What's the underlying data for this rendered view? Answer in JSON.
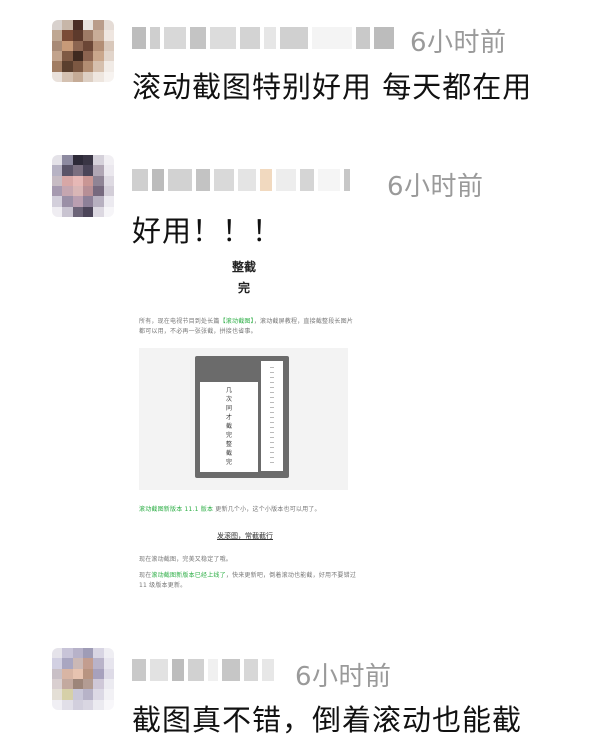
{
  "comments": [
    {
      "time": "6小时前",
      "text": "滚动截图特别好用 每天都在用"
    },
    {
      "time": "6小时前",
      "text": "好用！！！",
      "image": {
        "title_vertical": "整截完",
        "para1_plain_a": "所有，现在电视节目到处长篇",
        "para1_green": "【滚动截图】",
        "para1_plain_b": "，滚动截屏教程，直接截整段长图片都可以用，不必再一张张截，拼接也省事。",
        "phone_vertical": "几次同才截完整截完",
        "caption_green": "滚动截图新版本 11.1 版本",
        "caption_plain": "更新几个小，这个小版本也可以用了。",
        "link_text": "发滚图，常截截行",
        "para2": "现在滚动截图，完美又稳定了哦。",
        "para3_plain_a": "现在",
        "para3_green": "滚动截图新版本已经上线了",
        "para3_plain_b": "，快来更新吧，倒着滚动也能截，好用不要错过 11 级版本更新。"
      }
    },
    {
      "time": "6小时前",
      "text": "截图真不错，倒着滚动也能截"
    }
  ]
}
